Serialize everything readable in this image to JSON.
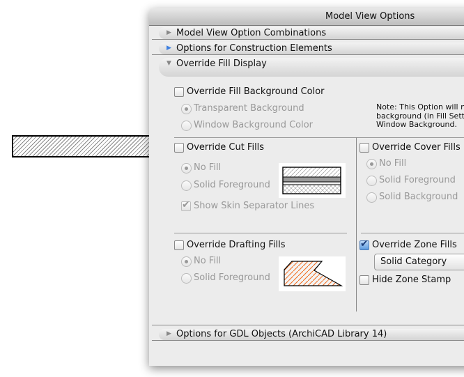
{
  "window": {
    "title": "Model View Options"
  },
  "sections": [
    {
      "label": "Model View Option Combinations",
      "state": "collapsed"
    },
    {
      "label": "Options for Construction Elements",
      "state": "collapsed-highlighted"
    },
    {
      "label": "Override Fill Display",
      "state": "expanded"
    },
    {
      "label": "Options for GDL Objects (ArchiCAD Library 14)",
      "state": "collapsed"
    }
  ],
  "background_fill": {
    "label": "Override Fill Background Color",
    "checked": false,
    "options": [
      "Transparent Background",
      "Window Background Color"
    ],
    "selected": 0,
    "note": [
      "Note: This Option will n",
      "background (in Fill Setti",
      "Window Background."
    ]
  },
  "cut_fills": {
    "label": "Override Cut Fills",
    "checked": false,
    "options": [
      "No Fill",
      "Solid Foreground"
    ],
    "selected": 0,
    "skin_lines": {
      "label": "Show Skin Separator Lines",
      "checked": true
    }
  },
  "cover_fills": {
    "label": "Override Cover Fills",
    "checked": false,
    "options": [
      "No Fill",
      "Solid Foreground",
      "Solid Background"
    ],
    "selected": 0
  },
  "drafting_fills": {
    "label": "Override Drafting Fills",
    "checked": false,
    "options": [
      "No Fill",
      "Solid Foreground"
    ],
    "selected": 0,
    "preview_color": "#f26a1b"
  },
  "zone_fills": {
    "label": "Override Zone Fills",
    "checked": true,
    "dropdown": "Solid Category",
    "hide_stamp": {
      "label": "Hide Zone Stamp",
      "checked": false
    }
  }
}
